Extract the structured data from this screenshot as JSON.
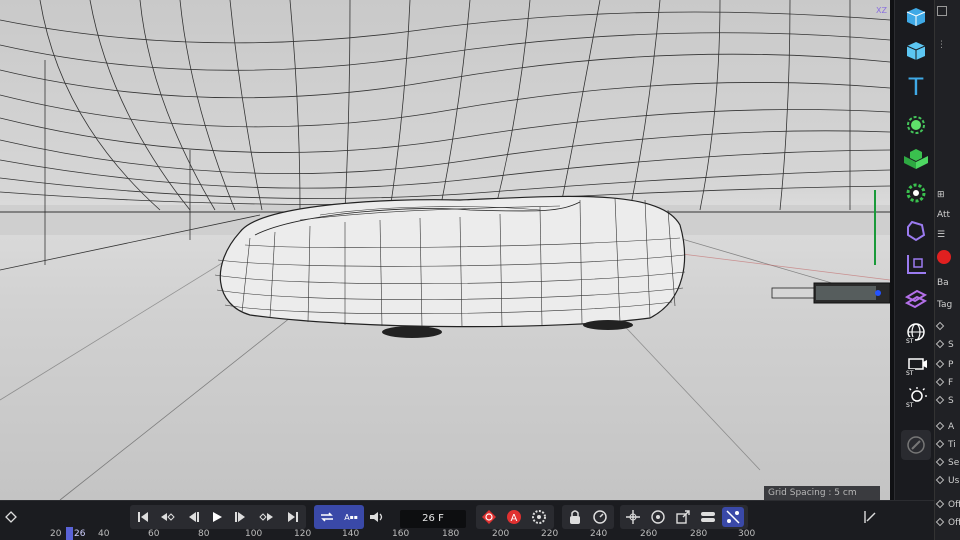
{
  "viewport": {
    "axis_label": "XZ",
    "grid_spacing": "Grid Spacing : 5 cm"
  },
  "side_toolbar": {
    "tools": [
      {
        "name": "cube-icon"
      },
      {
        "name": "text-spline-icon",
        "glyph": "T"
      },
      {
        "name": "null-target-icon"
      },
      {
        "name": "generator-icon"
      },
      {
        "name": "deformer-icon"
      },
      {
        "name": "sculpt-icon"
      },
      {
        "name": "axis-icon"
      },
      {
        "name": "field-icon"
      },
      {
        "name": "environment-icon",
        "tag": "ST"
      },
      {
        "name": "camera-icon",
        "tag": "ST"
      },
      {
        "name": "light-icon",
        "tag": "ST"
      },
      {
        "name": "edit-icon"
      }
    ]
  },
  "attr_panel": {
    "labels": [
      "Att",
      "Ba",
      "Tag",
      "S",
      "P",
      "F",
      "S",
      "A",
      "Ti",
      "Se",
      "Us",
      "Off",
      "Off"
    ]
  },
  "timeline": {
    "frame": "26 F",
    "ruler": [
      "20",
      "26",
      "40",
      "60",
      "80",
      "100",
      "120",
      "140",
      "160",
      "180",
      "200",
      "220",
      "240",
      "260",
      "280",
      "300"
    ],
    "colors": {
      "accent": "#3a49a8",
      "record": "#e03131"
    }
  }
}
